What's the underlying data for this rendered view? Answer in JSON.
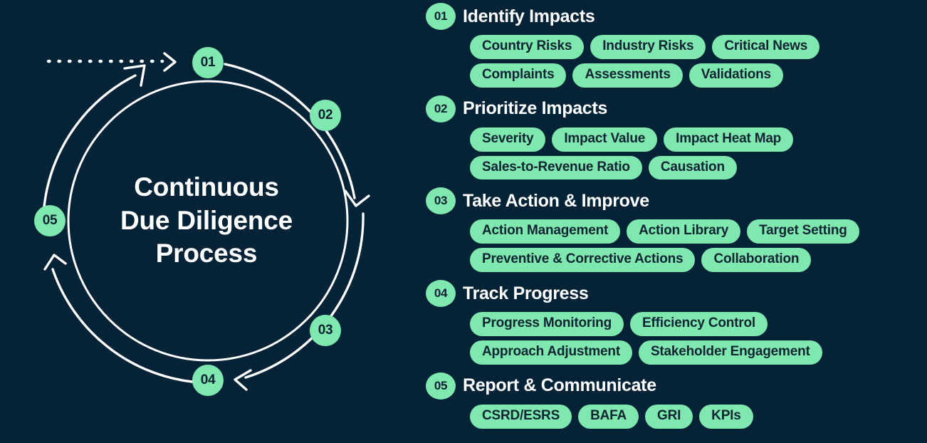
{
  "colors": {
    "background": "#042337",
    "accent": "#7ee8ae",
    "text_light": "#ffffff",
    "text_dark": "#102433",
    "stroke": "#ffffff"
  },
  "diagram": {
    "center_title_line1": "Continuous",
    "center_title_line2": "Due Diligence",
    "center_title_line3": "Process",
    "nodes": [
      {
        "id": "01",
        "label": "01"
      },
      {
        "id": "02",
        "label": "02"
      },
      {
        "id": "03",
        "label": "03"
      },
      {
        "id": "04",
        "label": "04"
      },
      {
        "id": "05",
        "label": "05"
      }
    ]
  },
  "steps": [
    {
      "number": "01",
      "title": "Identify Impacts",
      "rows": [
        [
          "Country Risks",
          "Industry Risks",
          "Critical News"
        ],
        [
          "Complaints",
          "Assessments",
          "Validations"
        ]
      ]
    },
    {
      "number": "02",
      "title": "Prioritize Impacts",
      "rows": [
        [
          "Severity",
          "Impact Value",
          "Impact Heat Map"
        ],
        [
          "Sales-to-Revenue Ratio",
          "Causation"
        ]
      ]
    },
    {
      "number": "03",
      "title": "Take Action & Improve",
      "rows": [
        [
          "Action Management",
          "Action Library",
          "Target Setting"
        ],
        [
          "Preventive & Corrective Actions",
          "Collaboration"
        ]
      ]
    },
    {
      "number": "04",
      "title": "Track Progress",
      "rows": [
        [
          "Progress Monitoring",
          "Efficiency Control"
        ],
        [
          "Approach Adjustment",
          "Stakeholder Engagement"
        ]
      ]
    },
    {
      "number": "05",
      "title": "Report & Communicate",
      "rows": [
        [
          "CSRD/ESRS",
          "BAFA",
          "GRI",
          "KPIs"
        ]
      ]
    }
  ]
}
